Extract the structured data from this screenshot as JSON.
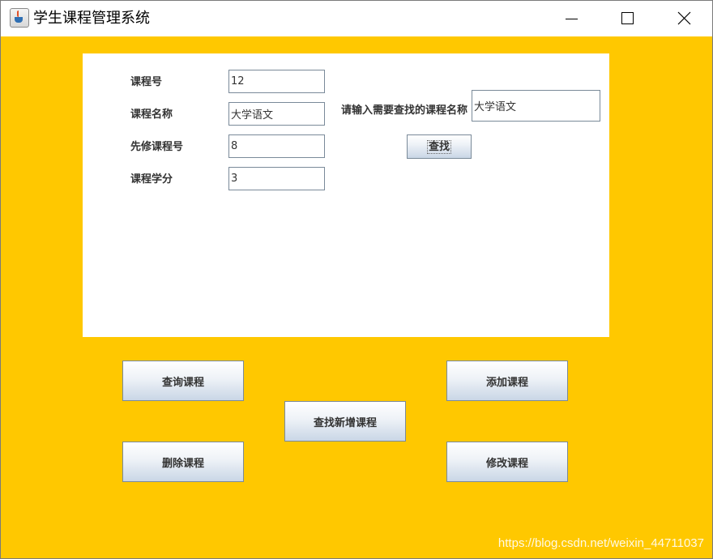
{
  "window": {
    "title": "学生课程管理系统"
  },
  "form": {
    "course_id_label": "课程号",
    "course_id_value": "12",
    "course_name_label": "课程名称",
    "course_name_value": "大学语文",
    "prereq_label": "先修课程号",
    "prereq_value": "8",
    "credit_label": "课程学分",
    "credit_value": "3"
  },
  "search": {
    "label": "请输入需要查找的课程名称",
    "value": "大学语文",
    "button_label": "查找"
  },
  "actions": {
    "query_label": "查询课程",
    "add_label": "添加课程",
    "find_new_label": "查找新增课程",
    "delete_label": "删除课程",
    "modify_label": "修改课程"
  },
  "watermark": "https://blog.csdn.net/weixin_44711037",
  "colors": {
    "background": "#ffc800",
    "panel": "#ffffff"
  }
}
